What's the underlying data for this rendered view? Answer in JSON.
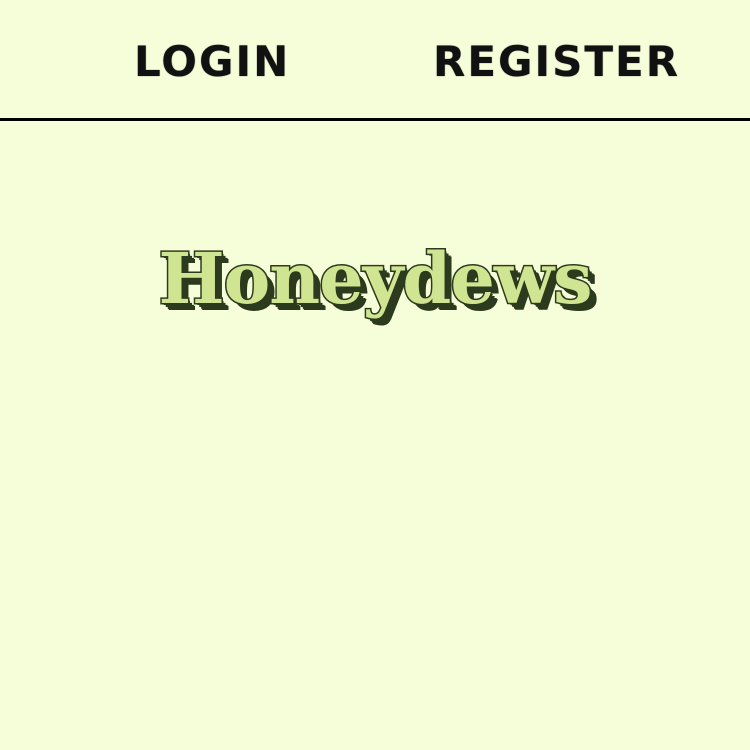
{
  "nav": {
    "login_label": "LOGIN",
    "register_label": "REGISTER"
  },
  "hero": {
    "title": "Honeydews"
  },
  "colors": {
    "background": "#f6fdd9",
    "nav_text": "#111111",
    "divider": "#000000",
    "title_fill": "#cfe591",
    "title_outline": "#2c3a1d"
  }
}
